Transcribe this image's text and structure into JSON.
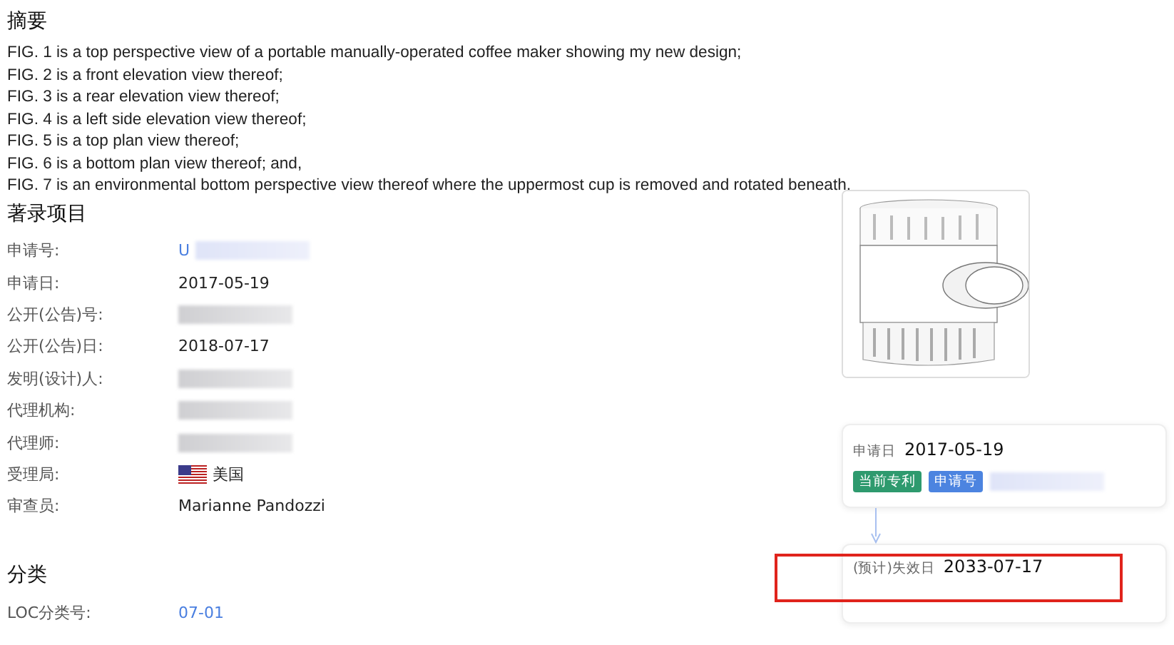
{
  "abstract": {
    "title": "摘要",
    "lines": [
      "FIG. 1 is a top perspective view of a portable manually-operated coffee maker showing my new design;",
      "FIG. 2 is a front elevation view thereof;",
      "FIG. 3 is a rear elevation view thereof;",
      "FIG. 4 is a left side elevation view thereof;",
      "FIG. 5 is a top plan view thereof;",
      "FIG. 6 is a bottom plan view thereof; and,",
      "FIG. 7 is an environmental bottom perspective view thereof where the uppermost cup is removed and rotated beneath."
    ]
  },
  "bibliography": {
    "title": "著录项目",
    "rows": [
      {
        "label": "申请号:",
        "kind": "link",
        "value": "U",
        "redacted": true
      },
      {
        "label": "申请日:",
        "kind": "text",
        "value": "2017-05-19",
        "redacted": false
      },
      {
        "label": "公开(公告)号:",
        "kind": "text",
        "redacted": true
      },
      {
        "label": "公开(公告)日:",
        "kind": "text",
        "value": "2018-07-17",
        "redacted": false
      },
      {
        "label": "发明(设计)人:",
        "kind": "text",
        "redacted": true
      },
      {
        "label": "代理机构:",
        "kind": "text",
        "redacted": true
      },
      {
        "label": "代理师:",
        "kind": "text",
        "redacted": true
      },
      {
        "label": "受理局:",
        "kind": "flag",
        "value": "美国",
        "redacted": false
      },
      {
        "label": "审查员:",
        "kind": "text",
        "value": "Marianne Pandozzi",
        "redacted": false
      }
    ]
  },
  "classification": {
    "title": "分类",
    "rows": [
      {
        "label": "LOC分类号:",
        "kind": "link",
        "value": "07-01",
        "redacted": false
      }
    ]
  },
  "timeline": [
    {
      "label": "申请日",
      "date": "2017-05-19",
      "tags": [
        {
          "text": "当前专利",
          "color": "#2e9a6e"
        },
        {
          "text": "申请号",
          "color": "#4c84e0"
        }
      ]
    },
    {
      "label": "(预计)失效日",
      "date": "2033-07-17"
    }
  ]
}
